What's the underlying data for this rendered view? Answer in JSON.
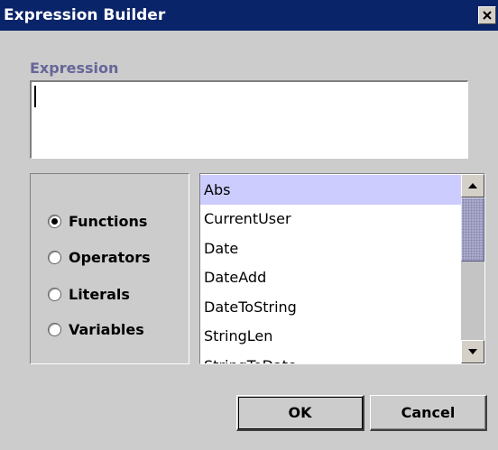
{
  "window": {
    "title": "Expression Builder",
    "close_icon": "close-icon"
  },
  "expression": {
    "label": "Expression",
    "value": ""
  },
  "radio_group": {
    "selected": "Functions",
    "options": [
      {
        "label": "Functions",
        "checked": true
      },
      {
        "label": "Operators",
        "checked": false
      },
      {
        "label": "Literals",
        "checked": false
      },
      {
        "label": "Variables",
        "checked": false
      }
    ]
  },
  "list": {
    "selected": "Abs",
    "items": [
      "Abs",
      "CurrentUser",
      "Date",
      "DateAdd",
      "DateToString",
      "StringLen",
      "StringToDate"
    ]
  },
  "buttons": {
    "ok_label": "OK",
    "cancel_label": "Cancel"
  },
  "colors": {
    "titlebar": "#0a246a",
    "selection": "#ccccff",
    "label_accent": "#666699"
  }
}
